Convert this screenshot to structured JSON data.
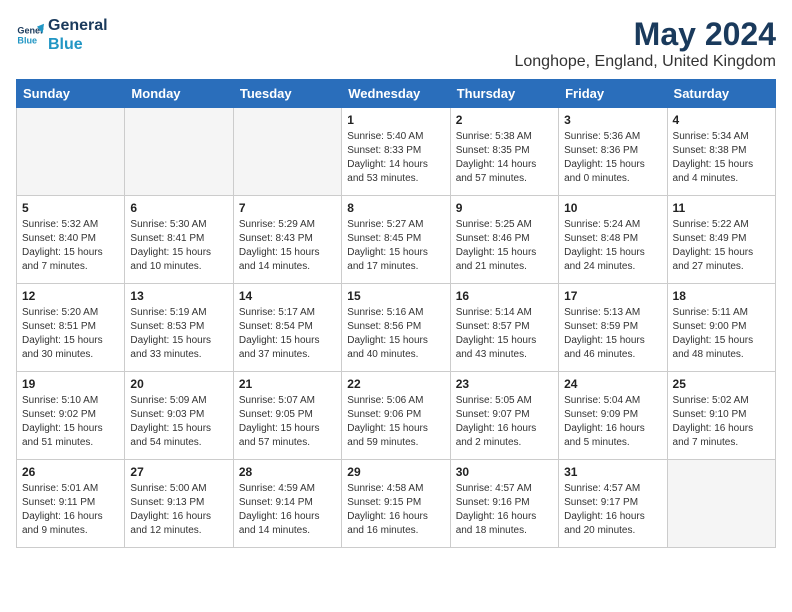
{
  "logo": {
    "line1": "General",
    "line2": "Blue"
  },
  "title": {
    "month_year": "May 2024",
    "location": "Longhope, England, United Kingdom"
  },
  "weekdays": [
    "Sunday",
    "Monday",
    "Tuesday",
    "Wednesday",
    "Thursday",
    "Friday",
    "Saturday"
  ],
  "weeks": [
    [
      {
        "day": "",
        "content": ""
      },
      {
        "day": "",
        "content": ""
      },
      {
        "day": "",
        "content": ""
      },
      {
        "day": "1",
        "content": "Sunrise: 5:40 AM\nSunset: 8:33 PM\nDaylight: 14 hours and 53 minutes."
      },
      {
        "day": "2",
        "content": "Sunrise: 5:38 AM\nSunset: 8:35 PM\nDaylight: 14 hours and 57 minutes."
      },
      {
        "day": "3",
        "content": "Sunrise: 5:36 AM\nSunset: 8:36 PM\nDaylight: 15 hours and 0 minutes."
      },
      {
        "day": "4",
        "content": "Sunrise: 5:34 AM\nSunset: 8:38 PM\nDaylight: 15 hours and 4 minutes."
      }
    ],
    [
      {
        "day": "5",
        "content": "Sunrise: 5:32 AM\nSunset: 8:40 PM\nDaylight: 15 hours and 7 minutes."
      },
      {
        "day": "6",
        "content": "Sunrise: 5:30 AM\nSunset: 8:41 PM\nDaylight: 15 hours and 10 minutes."
      },
      {
        "day": "7",
        "content": "Sunrise: 5:29 AM\nSunset: 8:43 PM\nDaylight: 15 hours and 14 minutes."
      },
      {
        "day": "8",
        "content": "Sunrise: 5:27 AM\nSunset: 8:45 PM\nDaylight: 15 hours and 17 minutes."
      },
      {
        "day": "9",
        "content": "Sunrise: 5:25 AM\nSunset: 8:46 PM\nDaylight: 15 hours and 21 minutes."
      },
      {
        "day": "10",
        "content": "Sunrise: 5:24 AM\nSunset: 8:48 PM\nDaylight: 15 hours and 24 minutes."
      },
      {
        "day": "11",
        "content": "Sunrise: 5:22 AM\nSunset: 8:49 PM\nDaylight: 15 hours and 27 minutes."
      }
    ],
    [
      {
        "day": "12",
        "content": "Sunrise: 5:20 AM\nSunset: 8:51 PM\nDaylight: 15 hours and 30 minutes."
      },
      {
        "day": "13",
        "content": "Sunrise: 5:19 AM\nSunset: 8:53 PM\nDaylight: 15 hours and 33 minutes."
      },
      {
        "day": "14",
        "content": "Sunrise: 5:17 AM\nSunset: 8:54 PM\nDaylight: 15 hours and 37 minutes."
      },
      {
        "day": "15",
        "content": "Sunrise: 5:16 AM\nSunset: 8:56 PM\nDaylight: 15 hours and 40 minutes."
      },
      {
        "day": "16",
        "content": "Sunrise: 5:14 AM\nSunset: 8:57 PM\nDaylight: 15 hours and 43 minutes."
      },
      {
        "day": "17",
        "content": "Sunrise: 5:13 AM\nSunset: 8:59 PM\nDaylight: 15 hours and 46 minutes."
      },
      {
        "day": "18",
        "content": "Sunrise: 5:11 AM\nSunset: 9:00 PM\nDaylight: 15 hours and 48 minutes."
      }
    ],
    [
      {
        "day": "19",
        "content": "Sunrise: 5:10 AM\nSunset: 9:02 PM\nDaylight: 15 hours and 51 minutes."
      },
      {
        "day": "20",
        "content": "Sunrise: 5:09 AM\nSunset: 9:03 PM\nDaylight: 15 hours and 54 minutes."
      },
      {
        "day": "21",
        "content": "Sunrise: 5:07 AM\nSunset: 9:05 PM\nDaylight: 15 hours and 57 minutes."
      },
      {
        "day": "22",
        "content": "Sunrise: 5:06 AM\nSunset: 9:06 PM\nDaylight: 15 hours and 59 minutes."
      },
      {
        "day": "23",
        "content": "Sunrise: 5:05 AM\nSunset: 9:07 PM\nDaylight: 16 hours and 2 minutes."
      },
      {
        "day": "24",
        "content": "Sunrise: 5:04 AM\nSunset: 9:09 PM\nDaylight: 16 hours and 5 minutes."
      },
      {
        "day": "25",
        "content": "Sunrise: 5:02 AM\nSunset: 9:10 PM\nDaylight: 16 hours and 7 minutes."
      }
    ],
    [
      {
        "day": "26",
        "content": "Sunrise: 5:01 AM\nSunset: 9:11 PM\nDaylight: 16 hours and 9 minutes."
      },
      {
        "day": "27",
        "content": "Sunrise: 5:00 AM\nSunset: 9:13 PM\nDaylight: 16 hours and 12 minutes."
      },
      {
        "day": "28",
        "content": "Sunrise: 4:59 AM\nSunset: 9:14 PM\nDaylight: 16 hours and 14 minutes."
      },
      {
        "day": "29",
        "content": "Sunrise: 4:58 AM\nSunset: 9:15 PM\nDaylight: 16 hours and 16 minutes."
      },
      {
        "day": "30",
        "content": "Sunrise: 4:57 AM\nSunset: 9:16 PM\nDaylight: 16 hours and 18 minutes."
      },
      {
        "day": "31",
        "content": "Sunrise: 4:57 AM\nSunset: 9:17 PM\nDaylight: 16 hours and 20 minutes."
      },
      {
        "day": "",
        "content": ""
      }
    ]
  ]
}
